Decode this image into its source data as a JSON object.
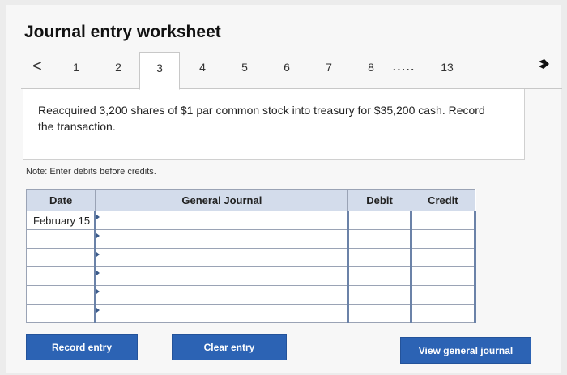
{
  "title": "Journal entry worksheet",
  "tabs": {
    "prev_label": "<",
    "items": [
      "1",
      "2",
      "3",
      "4",
      "5",
      "6",
      "7",
      "8",
      ".....",
      "13"
    ],
    "active_index": 2
  },
  "question": {
    "text": "Reacquired 3,200 shares of $1 par common stock into treasury for $35,200 cash. Record the transaction."
  },
  "note": "Note: Enter debits before credits.",
  "table": {
    "headers": {
      "date": "Date",
      "journal": "General Journal",
      "debit": "Debit",
      "credit": "Credit"
    },
    "rows": [
      {
        "date": "February 15",
        "account": "",
        "debit": "",
        "credit": ""
      },
      {
        "date": "",
        "account": "",
        "debit": "",
        "credit": ""
      },
      {
        "date": "",
        "account": "",
        "debit": "",
        "credit": ""
      },
      {
        "date": "",
        "account": "",
        "debit": "",
        "credit": ""
      },
      {
        "date": "",
        "account": "",
        "debit": "",
        "credit": ""
      },
      {
        "date": "",
        "account": "",
        "debit": "",
        "credit": ""
      }
    ]
  },
  "buttons": {
    "record": "Record entry",
    "clear": "Clear entry",
    "view": "View general journal"
  },
  "colors": {
    "button_blue": "#2c63b4",
    "header_blue": "#d3dceb"
  },
  "icons": {
    "next": "next-arrow-icon"
  }
}
